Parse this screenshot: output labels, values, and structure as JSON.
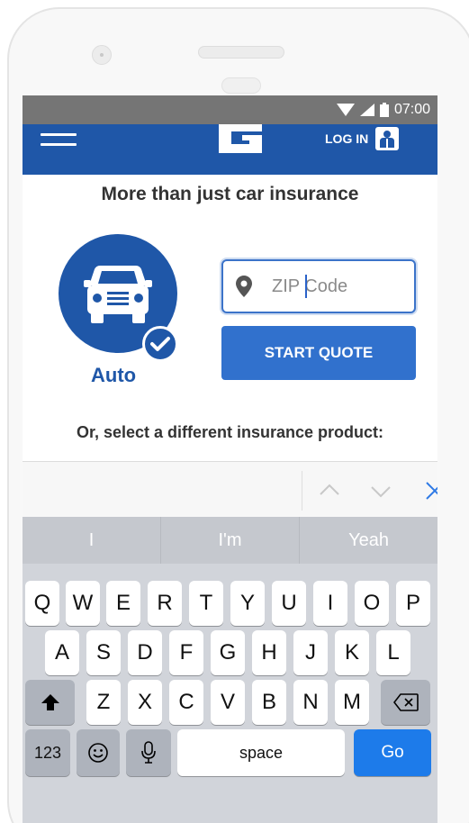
{
  "status_bar": {
    "time": "07:00"
  },
  "app_bar": {
    "logo_letter": "G",
    "login_label": "LOG IN"
  },
  "headline": "More than just car insurance",
  "product": {
    "name": "Auto"
  },
  "zip": {
    "placeholder": "ZIP Code"
  },
  "start_quote_label": "START QUOTE",
  "subheadline": "Or, select a different insurance product:",
  "keyboard": {
    "suggestions": [
      "I",
      "I'm",
      "Yeah"
    ],
    "row1": [
      "Q",
      "W",
      "E",
      "R",
      "T",
      "Y",
      "U",
      "I",
      "O",
      "P"
    ],
    "row2": [
      "A",
      "S",
      "D",
      "F",
      "G",
      "H",
      "J",
      "K",
      "L"
    ],
    "row3": [
      "Z",
      "X",
      "C",
      "V",
      "B",
      "N",
      "M"
    ],
    "numbers_label": "123",
    "space_label": "space",
    "go_label": "Go"
  },
  "colors": {
    "brand_blue": "#1f57a8",
    "button_blue": "#3171cd",
    "go_blue": "#1d7bea"
  }
}
